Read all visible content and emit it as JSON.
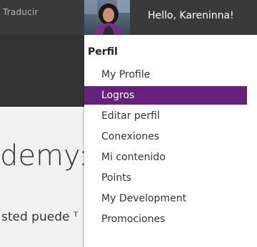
{
  "header": {
    "translate_label": "Traducir",
    "greeting": "Hello, Kareninna!"
  },
  "page": {
    "heading_fragment": "demy:",
    "text_fragment": "sted puede ᵀ"
  },
  "menu": {
    "header": "Perfil",
    "items": [
      {
        "label": "My Profile",
        "active": false
      },
      {
        "label": "Logros",
        "active": true
      },
      {
        "label": "Editar perfil",
        "active": false
      },
      {
        "label": "Conexiones",
        "active": false
      },
      {
        "label": "Mi contenido",
        "active": false
      },
      {
        "label": "Points",
        "active": false
      },
      {
        "label": "My Development",
        "active": false
      },
      {
        "label": "Promociones",
        "active": false
      }
    ]
  },
  "colors": {
    "active_item_bg": "#68217a",
    "topbar_bg": "#3a3a3a"
  }
}
